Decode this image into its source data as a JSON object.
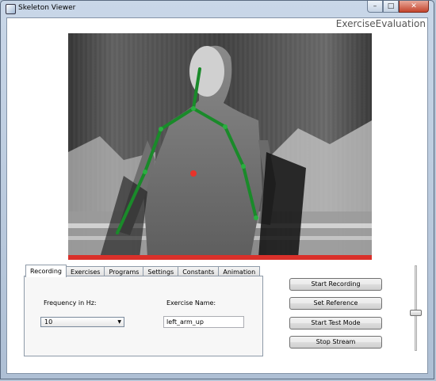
{
  "window": {
    "title": "Skeleton Viewer",
    "controls": {
      "minimize": "–",
      "maximize": "□",
      "close": "✕"
    }
  },
  "header": {
    "title": "ExerciseEvaluation"
  },
  "stream": {
    "content": "depth image with tracked skeleton overlay",
    "bone_color": "#1a8a2a",
    "center_marker_color": "#e8332a",
    "status_bar_color": "#d9302a"
  },
  "tabs": [
    {
      "label": "Recording",
      "active": true
    },
    {
      "label": "Exercises",
      "active": false
    },
    {
      "label": "Programs",
      "active": false
    },
    {
      "label": "Settings",
      "active": false
    },
    {
      "label": "Constants",
      "active": false
    },
    {
      "label": "Animation",
      "active": false
    }
  ],
  "recording_panel": {
    "frequency_label": "Frequency in Hz:",
    "frequency_value": "10",
    "exercise_label": "Exercise Name:",
    "exercise_value": "left_arm_up"
  },
  "buttons": {
    "start_recording": "Start Recording",
    "set_reference": "Set Reference",
    "start_test_mode": "Start Test Mode",
    "stop_stream": "Stop Stream"
  },
  "slider": {
    "level": 0.5
  }
}
